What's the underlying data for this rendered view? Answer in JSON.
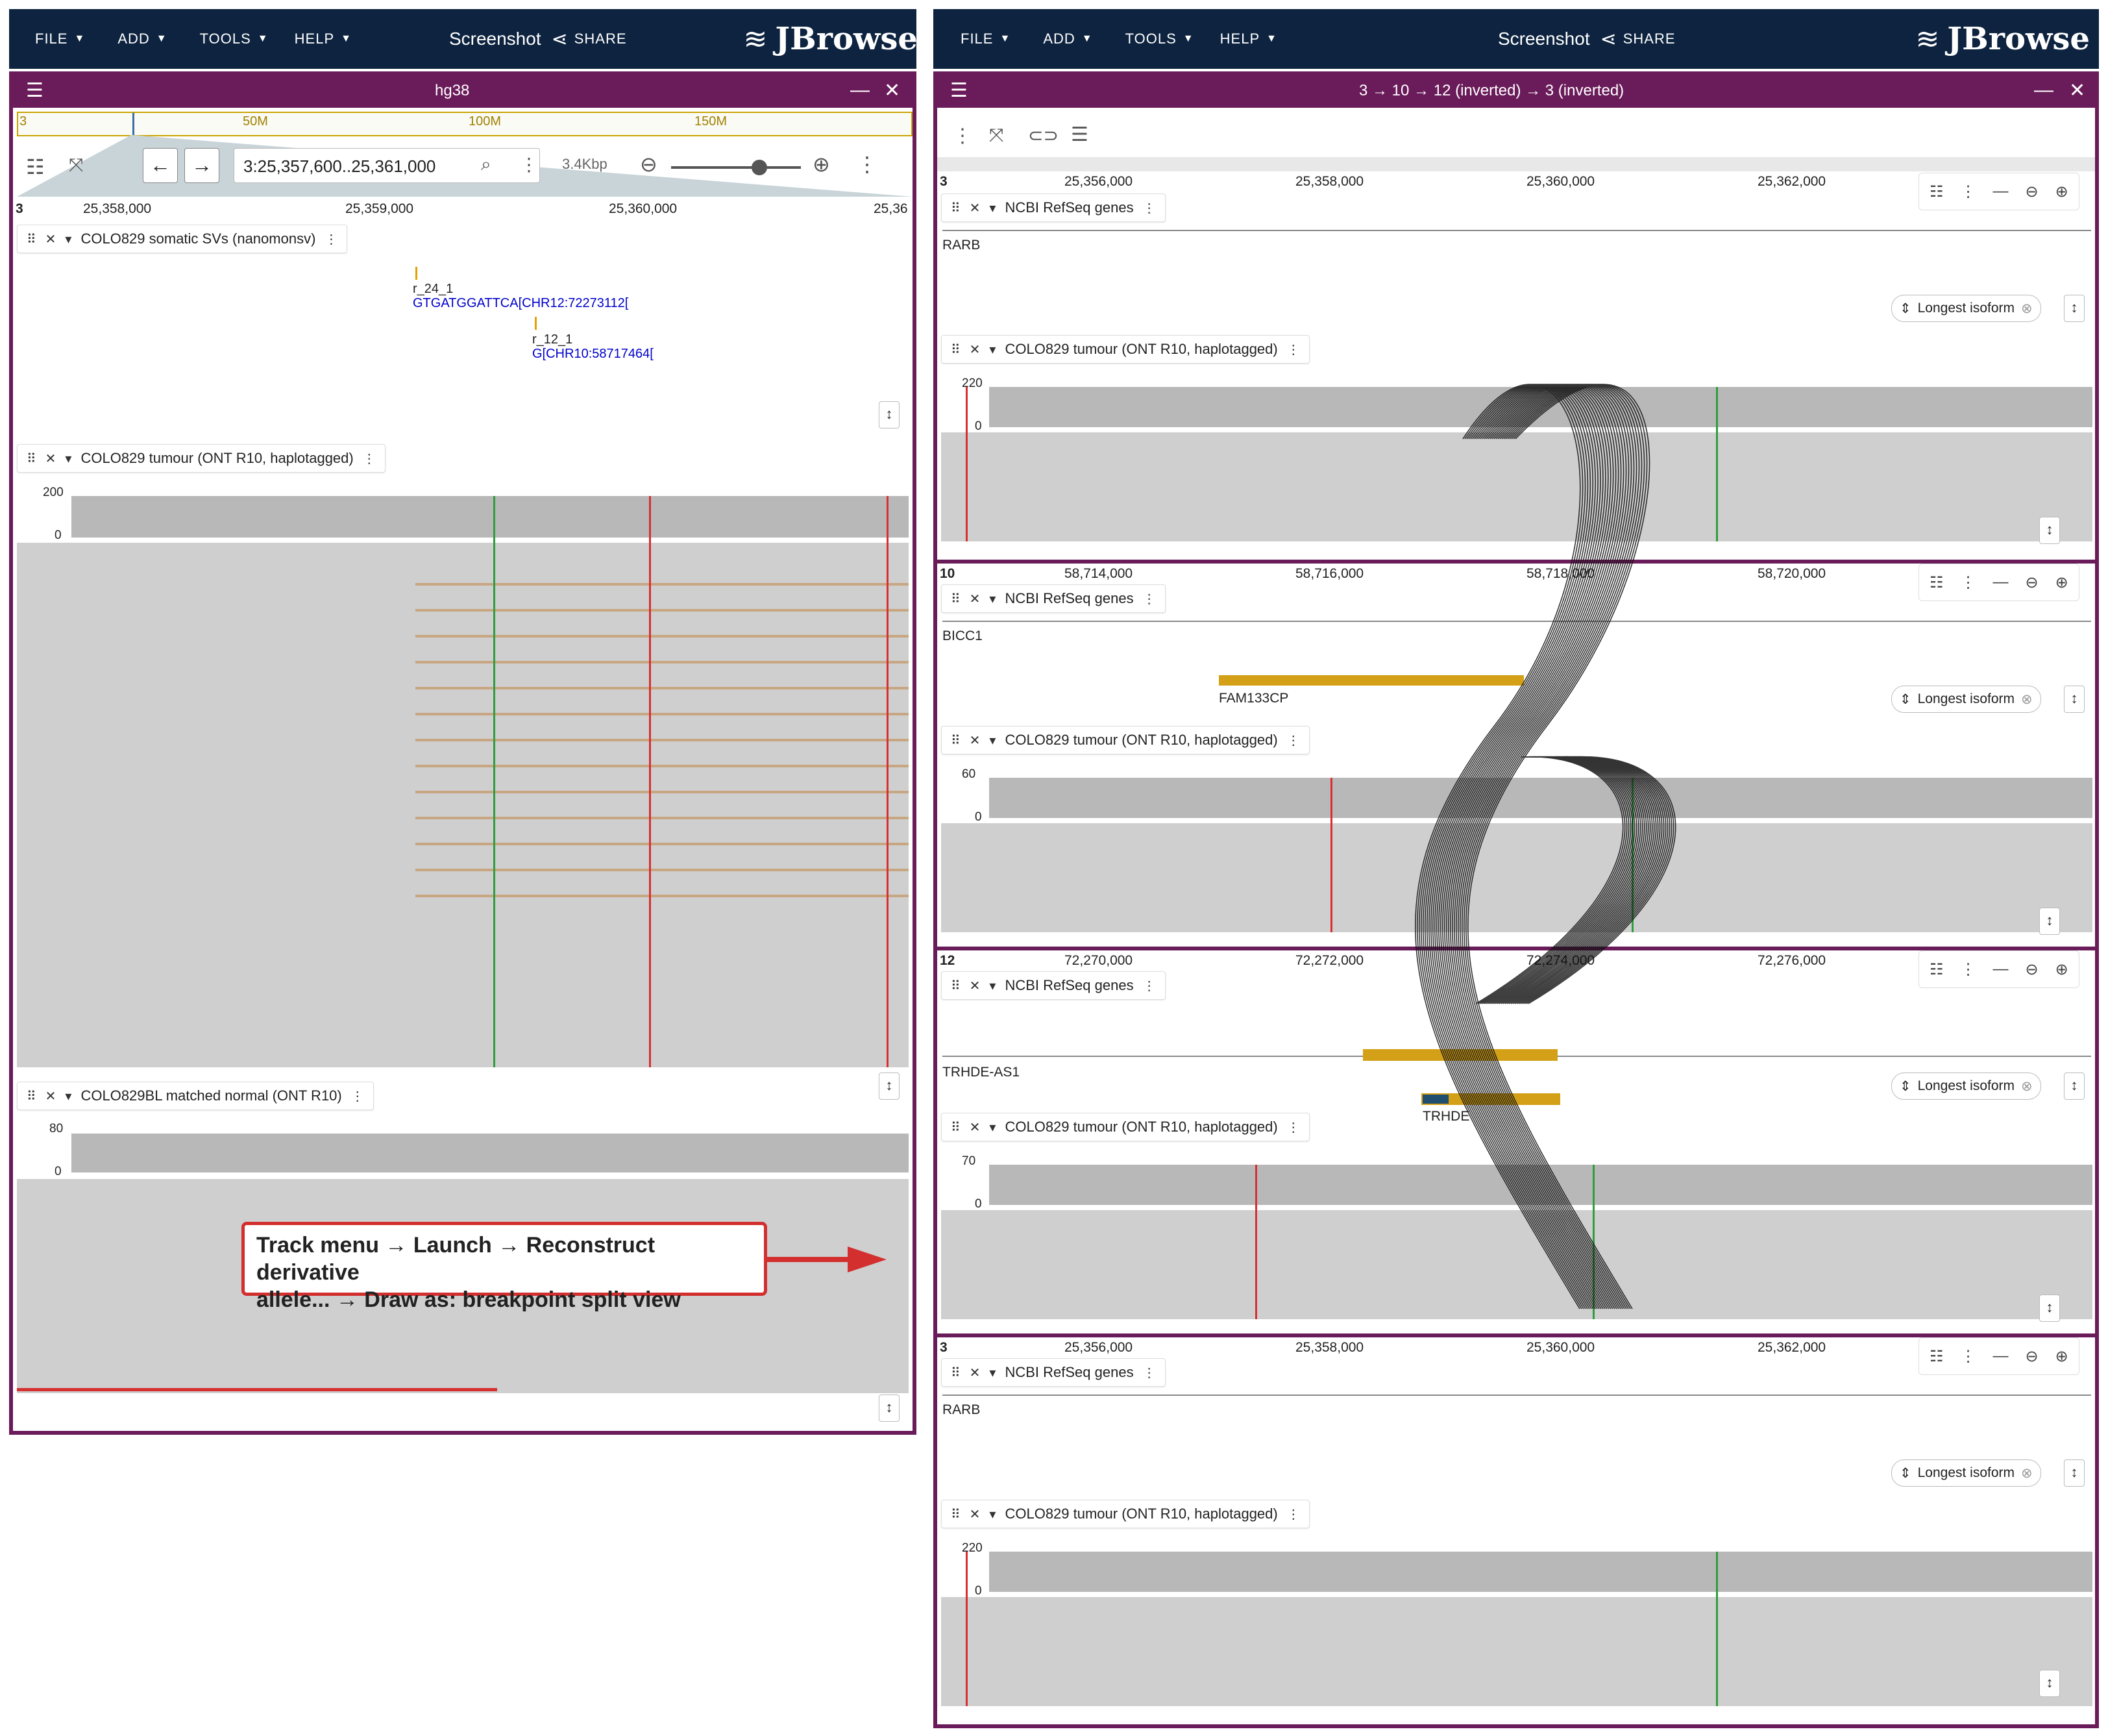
{
  "appbar": {
    "menus": [
      "FILE",
      "ADD",
      "TOOLS",
      "HELP"
    ],
    "screenshot": "Screenshot",
    "share": "SHARE",
    "logo": "JBrowse"
  },
  "left": {
    "view_title": "hg38",
    "overview_ticks": [
      "3",
      "50M",
      "100M",
      "150M"
    ],
    "location": "3:25,357,600..25,361,000",
    "span": "3.4Kbp",
    "chrom": "3",
    "ruler_ticks": [
      "25,358,000",
      "25,359,000",
      "25,360,000",
      "25,36"
    ],
    "tracks": [
      {
        "name": "COLO829 somatic SVs (nanomonsv)"
      },
      {
        "name": "COLO829 tumour (ONT R10, haplotagged)",
        "ymax": "200",
        "ymin": "0"
      },
      {
        "name": "COLO829BL matched normal (ONT R10)",
        "ymax": "80",
        "ymin": "0"
      }
    ],
    "sv_features": [
      {
        "id": "r_24_1",
        "alt": "GTGATGGATTCA[CHR12:72273112["
      },
      {
        "id": "r_12_1",
        "alt": "G[CHR10:58717464["
      }
    ],
    "callout_line1": "Track menu → Launch → Reconstruct derivative",
    "callout_line2": "allele... → Draw as: breakpoint split view"
  },
  "right": {
    "view_title": "3 → 10 → 12 (inverted) → 3 (inverted)",
    "panels": [
      {
        "chrom": "3",
        "ticks": [
          "25,356,000",
          "25,358,000",
          "25,360,000",
          "25,362,000"
        ],
        "gene_track": "NCBI RefSeq genes",
        "genes": [
          "RARB"
        ],
        "reads_track": "COLO829 tumour (ONT R10, haplotagged)",
        "ymax": "220",
        "ymin": "0",
        "isoform": "Longest isoform"
      },
      {
        "chrom": "10",
        "ticks": [
          "58,714,000",
          "58,716,000",
          "58,718,000",
          "58,720,000"
        ],
        "gene_track": "NCBI RefSeq genes",
        "genes": [
          "BICC1",
          "FAM133CP"
        ],
        "reads_track": "COLO829 tumour (ONT R10, haplotagged)",
        "ymax": "60",
        "ymin": "0",
        "isoform": "Longest isoform"
      },
      {
        "chrom": "12",
        "ticks": [
          "72,270,000",
          "72,272,000",
          "72,274,000",
          "72,276,000"
        ],
        "gene_track": "NCBI RefSeq genes",
        "genes": [
          "TRHDE-AS1",
          "TRHDE"
        ],
        "reads_track": "COLO829 tumour (ONT R10, haplotagged)",
        "ymax": "70",
        "ymin": "0",
        "isoform": "Longest isoform"
      },
      {
        "chrom": "3",
        "ticks": [
          "25,356,000",
          "25,358,000",
          "25,360,000",
          "25,362,000"
        ],
        "gene_track": "NCBI RefSeq genes",
        "genes": [
          "RARB"
        ],
        "reads_track": "COLO829 tumour (ONT R10, haplotagged)",
        "ymax": "220",
        "ymin": "0",
        "isoform": "Longest isoform"
      }
    ]
  },
  "colors": {
    "appbar": "#0d233f",
    "view_border": "#6a1b5a",
    "callout": "#d32f2f",
    "gene": "#d4a017"
  }
}
